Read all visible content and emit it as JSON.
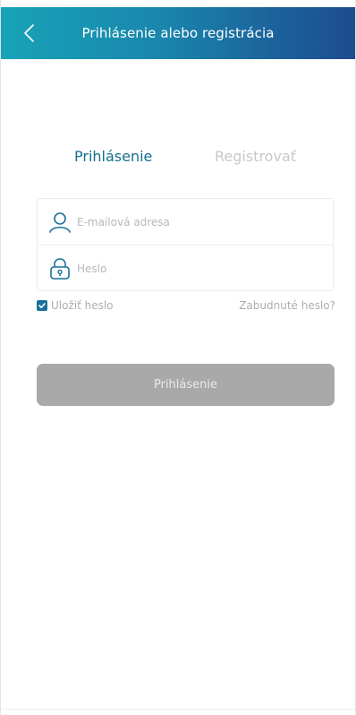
{
  "header": {
    "title": "Prihlásenie alebo registrácia",
    "back_icon": "chevron-left-icon"
  },
  "tabs": [
    {
      "label": "Prihlásenie",
      "active": true
    },
    {
      "label": "Registrovať",
      "active": false
    }
  ],
  "form": {
    "email": {
      "value": "",
      "placeholder": "E-mailová adresa",
      "icon": "user-icon"
    },
    "password": {
      "value": "",
      "placeholder": "Heslo",
      "icon": "lock-icon"
    }
  },
  "options": {
    "remember_label": "Uložiť heslo",
    "remember_checked": true,
    "forgot_label": "Zabudnuté heslo?"
  },
  "login_button": {
    "label": "Prihlásenie"
  },
  "colors": {
    "accent": "#136f8c",
    "header_gradient_start": "#17a3b7",
    "header_gradient_end": "#1d4c90",
    "button_disabled": "#a9a9a9"
  }
}
